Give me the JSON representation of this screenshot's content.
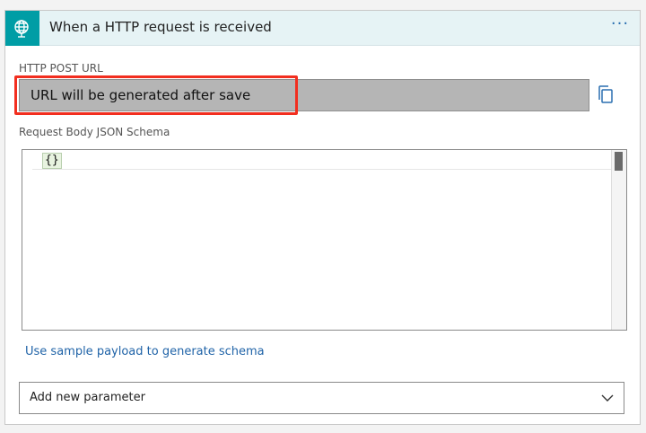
{
  "header": {
    "title": "When a HTTP request is received",
    "more_label": "···",
    "icon": "globe-request-icon",
    "accent_color": "#009DA5"
  },
  "url_field": {
    "label": "HTTP POST URL",
    "value": "URL will be generated after save",
    "highlight_color": "#F22E1F",
    "copy_icon": "copy-icon"
  },
  "schema": {
    "label": "Request Body JSON Schema",
    "value": "{}"
  },
  "sample_link": "Use sample payload to generate schema",
  "add_parameter": {
    "label": "Add new parameter",
    "icon": "chevron-down-icon"
  }
}
